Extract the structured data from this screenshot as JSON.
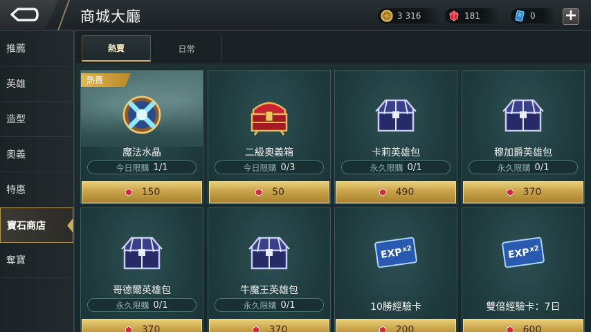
{
  "header": {
    "title": "商城大廳",
    "currencies": [
      {
        "name": "gold-coin",
        "icon": "gold-coin-icon",
        "value": "3 316"
      },
      {
        "name": "gem",
        "icon": "red-gem-icon",
        "value": "181"
      },
      {
        "name": "ticket",
        "icon": "blue-ticket-icon",
        "value": "0"
      }
    ],
    "plus_label": "+"
  },
  "sidebar": {
    "items": [
      {
        "label": "推薦",
        "active": false
      },
      {
        "label": "英雄",
        "active": false
      },
      {
        "label": "造型",
        "active": false
      },
      {
        "label": "奧義",
        "active": false
      },
      {
        "label": "特惠",
        "active": false
      },
      {
        "label": "寶石商店",
        "active": true
      },
      {
        "label": "奪寶",
        "active": false
      }
    ]
  },
  "tabs": [
    {
      "label": "熱賣",
      "active": true
    },
    {
      "label": "日常",
      "active": false
    }
  ],
  "products": [
    {
      "name": "魔法水晶",
      "badge": "熱賣",
      "limit_label": "今日限購",
      "limit_count": "1/1",
      "price": "150",
      "icon": "magic-crystal-icon"
    },
    {
      "name": "二級奧義箱",
      "limit_label": "今日限購",
      "limit_count": "0/3",
      "price": "50",
      "icon": "red-chest-icon"
    },
    {
      "name": "卡莉英雄包",
      "limit_label": "永久限購",
      "limit_count": "0/1",
      "price": "490",
      "icon": "hero-chest-icon"
    },
    {
      "name": "穆加爵英雄包",
      "limit_label": "永久限購",
      "limit_count": "0/1",
      "price": "370",
      "icon": "hero-chest-icon"
    },
    {
      "name": "哥德爾英雄包",
      "limit_label": "永久限購",
      "limit_count": "0/1",
      "price": "370",
      "icon": "hero-chest-icon"
    },
    {
      "name": "牛魔王英雄包",
      "limit_label": "永久限購",
      "limit_count": "0/1",
      "price": "370",
      "icon": "hero-chest-icon"
    },
    {
      "name": "10勝經驗卡",
      "price": "200",
      "icon": "exp-card-icon",
      "card_text": "EXP",
      "card_mult": "x2"
    },
    {
      "name": "雙倍經驗卡：7日",
      "price": "600",
      "icon": "exp-card-icon",
      "card_text": "EXP",
      "card_mult": "x2"
    }
  ],
  "colors": {
    "accent_gold": "#d7b35c",
    "price_gold": "#c9a24a",
    "card_bg": "#1f3b3e",
    "gem_red": "#d8263a"
  }
}
